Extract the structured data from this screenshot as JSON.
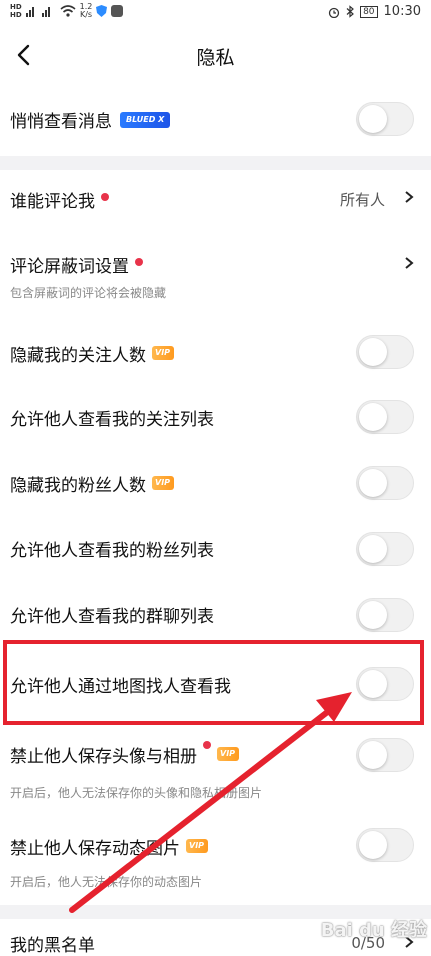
{
  "status": {
    "speed": "1.2\nK/s",
    "battery": "80",
    "time": "10:30"
  },
  "nav": {
    "title": "隐私"
  },
  "rows": {
    "stealth": {
      "label": "悄悄查看消息",
      "badge": "BLUED X"
    },
    "who_comment": {
      "label": "谁能评论我",
      "value": "所有人"
    },
    "comment_filter": {
      "label": "评论屏蔽词设置",
      "sub": "包含屏蔽词的评论将会被隐藏"
    },
    "hide_following_count": {
      "label": "隐藏我的关注人数",
      "badge": "VIP"
    },
    "allow_following_list": {
      "label": "允许他人查看我的关注列表"
    },
    "hide_fans_count": {
      "label": "隐藏我的粉丝人数",
      "badge": "VIP"
    },
    "allow_fans_list": {
      "label": "允许他人查看我的粉丝列表"
    },
    "allow_group_list": {
      "label": "允许他人查看我的群聊列表"
    },
    "allow_map": {
      "label": "允许他人通过地图找人查看我"
    },
    "block_save_avatar": {
      "label": "禁止他人保存头像与相册",
      "badge": "VIP",
      "sub": "开启后，他人无法保存你的头像和隐私相册图片"
    },
    "block_save_feed": {
      "label": "禁止他人保存动态图片",
      "badge": "VIP",
      "sub": "开启后，他人无法保存你的动态图片"
    },
    "blacklist": {
      "label": "我的黑名单",
      "value": "0/50"
    }
  },
  "colors": {
    "accent_red": "#e5222e",
    "vip_orange": "#ff9a1f",
    "blued_blue": "#1d54e8"
  },
  "watermark": "Bai du 经验"
}
